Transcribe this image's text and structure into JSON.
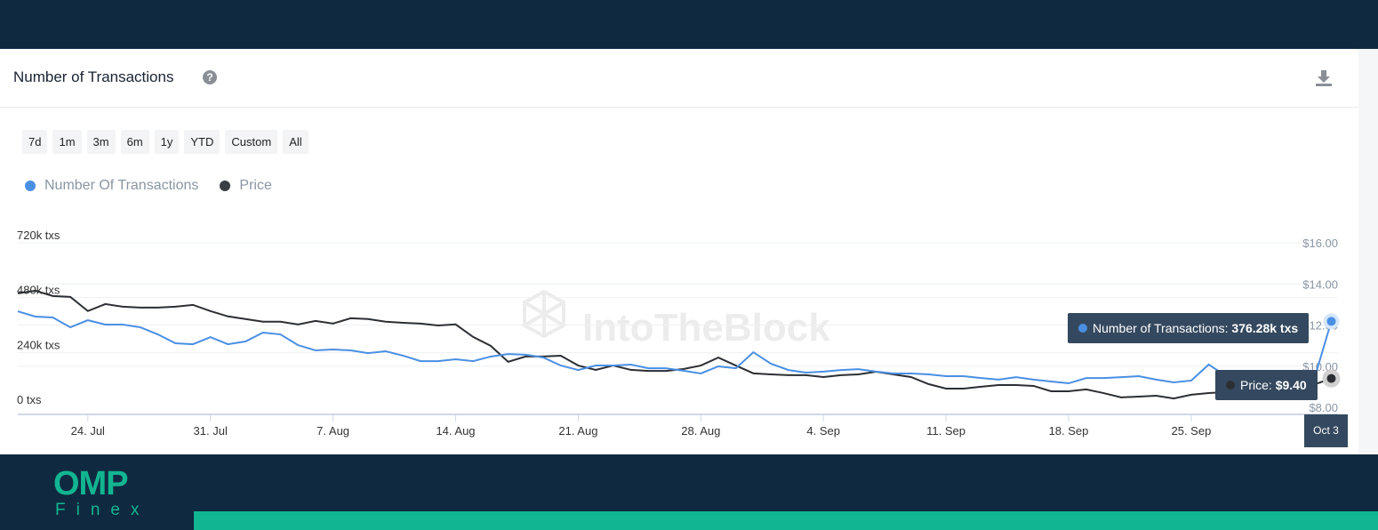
{
  "header": {
    "title": "Number of Transactions",
    "help_icon": "question-circle-icon",
    "download_icon": "download-icon"
  },
  "ranges": [
    "7d",
    "1m",
    "3m",
    "6m",
    "1y",
    "YTD",
    "Custom",
    "All"
  ],
  "watermark": "IntoTheBlock",
  "tooltip": {
    "tx_label": "Number of Transactions:",
    "tx_value": "376.28k txs",
    "price_label": "Price:",
    "price_value": "$9.40",
    "date": "Oct 3"
  },
  "footer": {
    "logo_top": "OMP",
    "logo_bottom": "Finex"
  },
  "colors": {
    "tx": "#4a8fe3",
    "price": "#2b2f33",
    "header": "#0f2a40",
    "accent": "#12b591"
  },
  "chart_data": {
    "type": "line",
    "legend": [
      "Number Of Transactions",
      "Price"
    ],
    "legend_placement": "top-left",
    "x_tick_labels": [
      "24. Jul",
      "31. Jul",
      "7. Aug",
      "14. Aug",
      "21. Aug",
      "28. Aug",
      "4. Sep",
      "11. Sep",
      "18. Sep",
      "25. Sep"
    ],
    "x_range": [
      "20 Jul",
      "3 Oct"
    ],
    "y_left": {
      "ticks": [
        "0 txs",
        "240k txs",
        "480k txs",
        "720k txs"
      ],
      "range": [
        0,
        720
      ],
      "unit": "k txs"
    },
    "y_right": {
      "ticks": [
        "$8.00",
        "$10.00",
        "$12.00",
        "$14.00",
        "$16.00"
      ],
      "range": [
        8,
        16
      ]
    },
    "grid": true,
    "series": [
      {
        "name": "Number Of Transactions",
        "axis": "left",
        "values": [
          420,
          397,
          393,
          350,
          381,
          362,
          362,
          350,
          319,
          280,
          276,
          307,
          276,
          288,
          327,
          319,
          272,
          249,
          253,
          249,
          237,
          245,
          226,
          202,
          202,
          210,
          202,
          222,
          233,
          230,
          218,
          183,
          163,
          183,
          183,
          187,
          171,
          171,
          160,
          148,
          179,
          171,
          241,
          191,
          163,
          152,
          156,
          163,
          167,
          156,
          148,
          148,
          144,
          136,
          136,
          128,
          121,
          132,
          121,
          113,
          105,
          128,
          128,
          132,
          136,
          121,
          109,
          117,
          187,
          136,
          121,
          117,
          117,
          117,
          117,
          376.28
        ]
      },
      {
        "name": "Price",
        "axis": "right",
        "values": [
          13.54,
          13.67,
          13.41,
          13.37,
          12.68,
          13.02,
          12.89,
          12.85,
          12.85,
          12.89,
          12.98,
          12.68,
          12.42,
          12.29,
          12.16,
          12.16,
          12.03,
          12.2,
          12.07,
          12.33,
          12.29,
          12.16,
          12.11,
          12.07,
          11.98,
          12.03,
          11.42,
          10.99,
          10.21,
          10.47,
          10.47,
          10.51,
          10.03,
          9.82,
          10.03,
          9.82,
          9.77,
          9.77,
          9.86,
          10.03,
          10.42,
          10.03,
          9.65,
          9.6,
          9.56,
          9.56,
          9.47,
          9.56,
          9.6,
          9.73,
          9.6,
          9.47,
          9.13,
          8.91,
          8.91,
          9.0,
          9.08,
          9.08,
          9.04,
          8.78,
          8.78,
          8.87,
          8.69,
          8.48,
          8.52,
          8.56,
          8.43,
          8.61,
          8.69,
          8.74,
          8.78,
          8.82,
          8.87,
          8.95,
          9.1,
          9.4
        ]
      }
    ]
  }
}
